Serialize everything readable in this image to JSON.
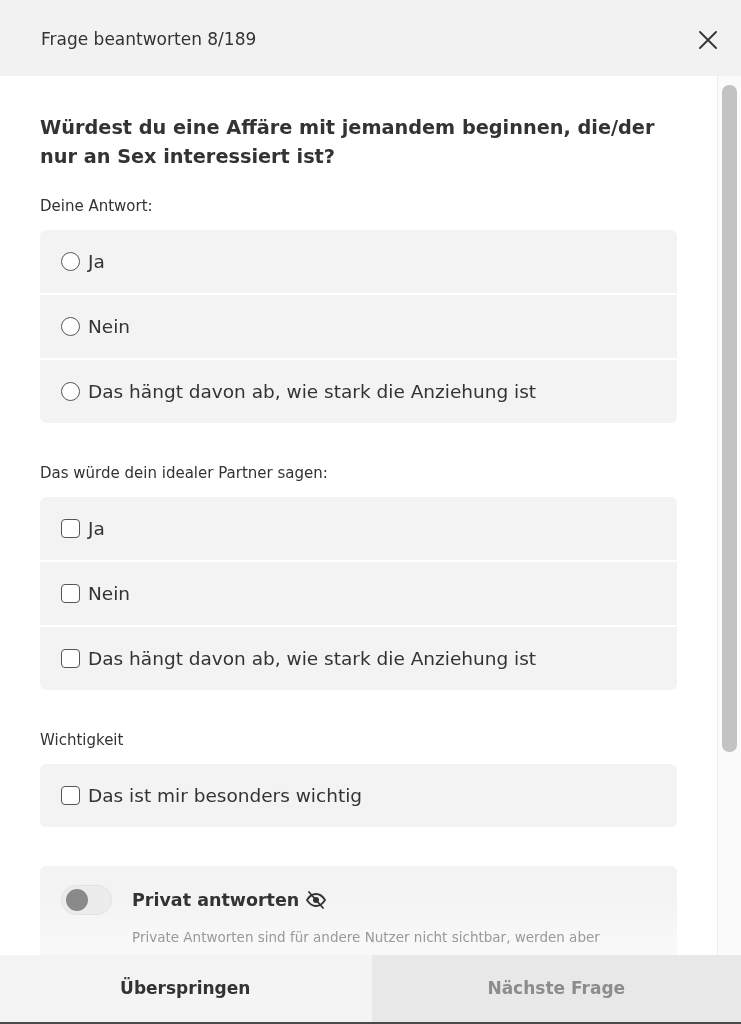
{
  "dialog": {
    "title": "Frage beantworten 8/189"
  },
  "question": "Würdest du eine Affäre mit jemandem beginnen, die/der nur an Sex interessiert ist?",
  "sections": [
    {
      "label": "Deine Antwort:",
      "kind": "radio",
      "options": [
        {
          "label": "Ja",
          "selected": false
        },
        {
          "label": "Nein",
          "selected": false
        },
        {
          "label": "Das hängt davon ab, wie stark die Anziehung ist",
          "selected": false
        }
      ]
    },
    {
      "label": "Das würde dein idealer Partner sagen:",
      "kind": "checkbox",
      "options": [
        {
          "label": "Ja",
          "checked": false
        },
        {
          "label": "Nein",
          "checked": false
        },
        {
          "label": "Das hängt davon ab, wie stark die Anziehung ist",
          "checked": false
        }
      ]
    },
    {
      "label": "Wichtigkeit",
      "kind": "checkbox",
      "options": [
        {
          "label": "Das ist mir besonders wichtig",
          "checked": false
        }
      ]
    }
  ],
  "private_answer": {
    "label": "Privat antworten",
    "on": false,
    "description": "Private Antworten sind für andere Nutzer nicht sichtbar, werden aber"
  },
  "footer": {
    "buttons": [
      {
        "label": "Überspringen",
        "disabled": false
      },
      {
        "label": "Nächste Frage",
        "disabled": true
      }
    ]
  }
}
